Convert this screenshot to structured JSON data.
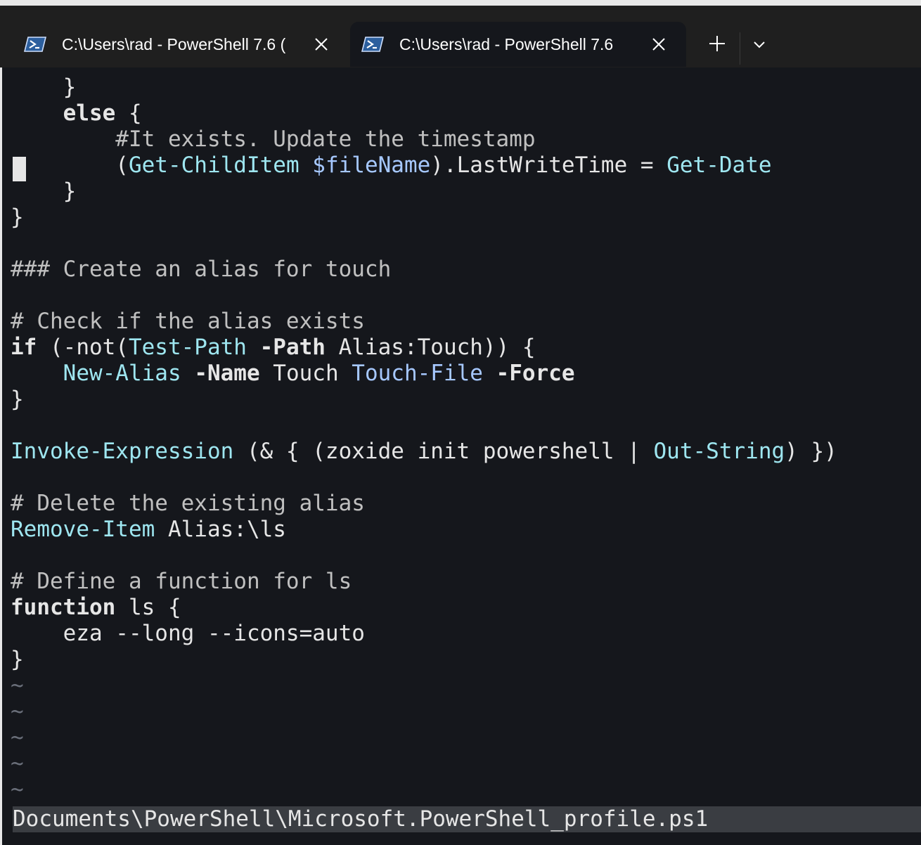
{
  "tabs": [
    {
      "title": "C:\\Users\\rad - PowerShell 7.6 (",
      "active": false
    },
    {
      "title": "C:\\Users\\rad - PowerShell 7.6",
      "active": true
    }
  ],
  "toolbar": {
    "new_tab_icon": "plus-icon",
    "dropdown_icon": "chevron-down-icon"
  },
  "editor": {
    "lines": [
      [
        {
          "t": "    }",
          "c": ""
        }
      ],
      [
        {
          "t": "    ",
          "c": ""
        },
        {
          "t": "else",
          "c": "b"
        },
        {
          "t": " {",
          "c": ""
        }
      ],
      [
        {
          "t": "        #It exists. Update the timestamp",
          "c": "cmt"
        }
      ],
      [
        {
          "t": "        (",
          "c": ""
        },
        {
          "t": "Get-ChildItem",
          "c": "cmd"
        },
        {
          "t": " ",
          "c": ""
        },
        {
          "t": "$fileName",
          "c": "var"
        },
        {
          "t": ").LastWriteTime = ",
          "c": ""
        },
        {
          "t": "Get-Date",
          "c": "cmd"
        }
      ],
      [
        {
          "t": "    }",
          "c": ""
        }
      ],
      [
        {
          "t": "}",
          "c": ""
        }
      ],
      [
        {
          "t": "",
          "c": ""
        }
      ],
      [
        {
          "t": "### Create an alias for touch",
          "c": "cmt"
        }
      ],
      [
        {
          "t": "",
          "c": ""
        }
      ],
      [
        {
          "t": "# Check if the alias exists",
          "c": "cmt"
        }
      ],
      [
        {
          "t": "if",
          "c": "b"
        },
        {
          "t": " (-not(",
          "c": ""
        },
        {
          "t": "Test-Path",
          "c": "cmd"
        },
        {
          "t": " ",
          "c": ""
        },
        {
          "t": "-Path",
          "c": "b"
        },
        {
          "t": " Alias:Touch)) {",
          "c": ""
        }
      ],
      [
        {
          "t": "    ",
          "c": ""
        },
        {
          "t": "New-Alias",
          "c": "cmd"
        },
        {
          "t": " ",
          "c": ""
        },
        {
          "t": "-Name",
          "c": "b"
        },
        {
          "t": " Touch ",
          "c": ""
        },
        {
          "t": "Touch-File",
          "c": "var"
        },
        {
          "t": " ",
          "c": ""
        },
        {
          "t": "-Force",
          "c": "b"
        }
      ],
      [
        {
          "t": "}",
          "c": ""
        }
      ],
      [
        {
          "t": "",
          "c": ""
        }
      ],
      [
        {
          "t": "Invoke-Expression",
          "c": "cmd"
        },
        {
          "t": " (& { (zoxide init powershell | ",
          "c": ""
        },
        {
          "t": "Out-String",
          "c": "cmd"
        },
        {
          "t": ") })",
          "c": ""
        }
      ],
      [
        {
          "t": "",
          "c": ""
        }
      ],
      [
        {
          "t": "# Delete the existing alias",
          "c": "cmt"
        }
      ],
      [
        {
          "t": "Remove-Item",
          "c": "cmd"
        },
        {
          "t": " Alias:\\ls",
          "c": ""
        }
      ],
      [
        {
          "t": "",
          "c": ""
        }
      ],
      [
        {
          "t": "# Define a function for ls",
          "c": "cmt"
        }
      ],
      [
        {
          "t": "function",
          "c": "b"
        },
        {
          "t": " ls {",
          "c": ""
        }
      ],
      [
        {
          "t": "    eza --long --icons=auto",
          "c": ""
        }
      ],
      [
        {
          "t": "}",
          "c": ""
        }
      ],
      [
        {
          "t": "~",
          "c": "tilde"
        }
      ],
      [
        {
          "t": "~",
          "c": "tilde"
        }
      ],
      [
        {
          "t": "~",
          "c": "tilde"
        }
      ],
      [
        {
          "t": "~",
          "c": "tilde"
        }
      ],
      [
        {
          "t": "~",
          "c": "tilde"
        }
      ]
    ]
  },
  "status_bar": {
    "file_path": "Documents\\PowerShell\\Microsoft.PowerShell_profile.ps1"
  },
  "colors": {
    "background": "#15171c",
    "command": "#9ee6f0",
    "variable": "#a6c8ff",
    "comment": "#c0c0c0"
  }
}
